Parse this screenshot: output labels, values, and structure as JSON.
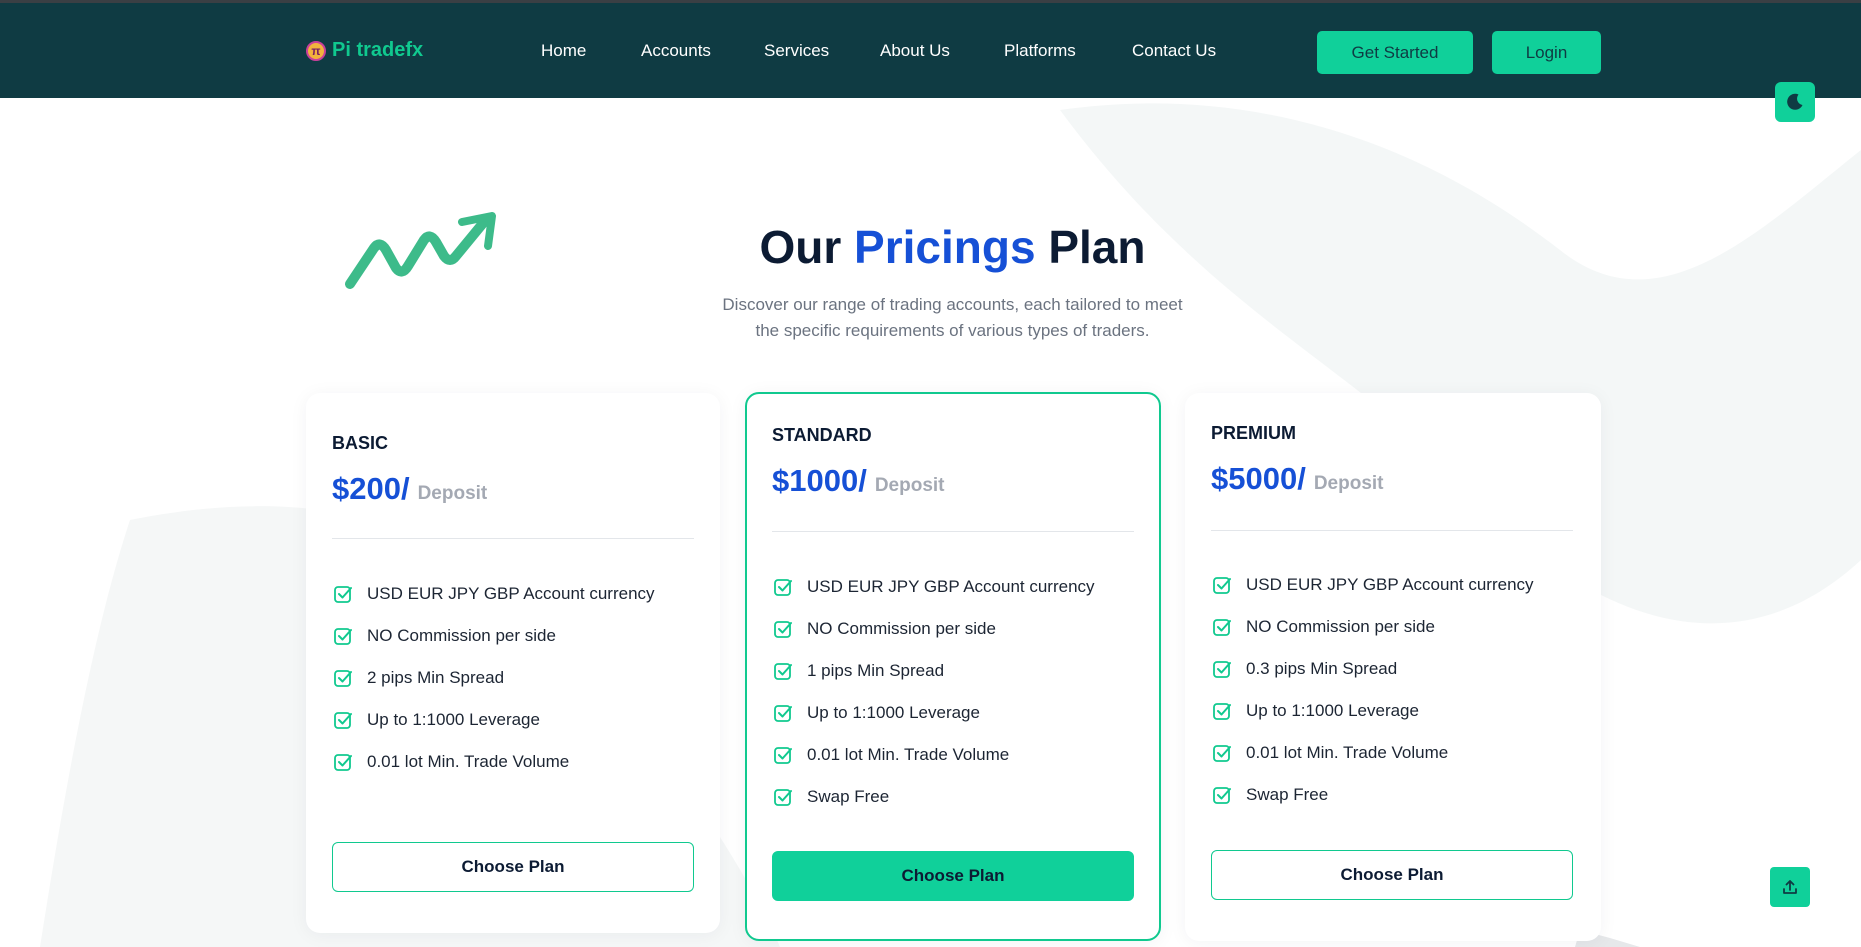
{
  "header": {
    "logo_text": "Pi tradefx",
    "logo_glyph": "π",
    "nav": [
      "Home",
      "Accounts",
      "Services",
      "About Us",
      "Platforms",
      "Contact Us"
    ],
    "get_started_label": "Get Started",
    "login_label": "Login"
  },
  "theme_toggle_icon": "moon-icon",
  "scroll_top_icon": "upload-icon",
  "pricing": {
    "title_part1": "Our",
    "title_highlight": "Pricings",
    "title_part2": "Plan",
    "subtitle_line1": "Discover our range of trading accounts, each tailored to meet",
    "subtitle_line2": "the specific requirements of various types of traders.",
    "plans": [
      {
        "name": "BASIC",
        "price": "$200/",
        "deposit_label": "Deposit",
        "features": [
          "USD EUR JPY GBP Account currency",
          "NO Commission per side",
          "2 pips Min Spread",
          "Up to 1:1000 Leverage",
          "0.01 lot Min. Trade Volume"
        ],
        "button_label": "Choose Plan"
      },
      {
        "name": "STANDARD",
        "price": "$1000/",
        "deposit_label": "Deposit",
        "features": [
          "USD EUR JPY GBP Account currency",
          "NO Commission per side",
          "1 pips Min Spread",
          "Up to 1:1000 Leverage",
          "0.01 lot Min. Trade Volume",
          "Swap Free"
        ],
        "button_label": "Choose Plan"
      },
      {
        "name": "PREMIUM",
        "price": "$5000/",
        "deposit_label": "Deposit",
        "features": [
          "USD EUR JPY GBP Account currency",
          "NO Commission per side",
          "0.3 pips Min Spread",
          "Up to 1:1000 Leverage",
          "0.01 lot Min. Trade Volume",
          "Swap Free"
        ],
        "button_label": "Choose Plan"
      }
    ]
  },
  "colors": {
    "header_bg": "#0f3b43",
    "accent_green": "#10d09a",
    "brand_blue": "#1650d6",
    "dark_text": "#0c1b33"
  }
}
